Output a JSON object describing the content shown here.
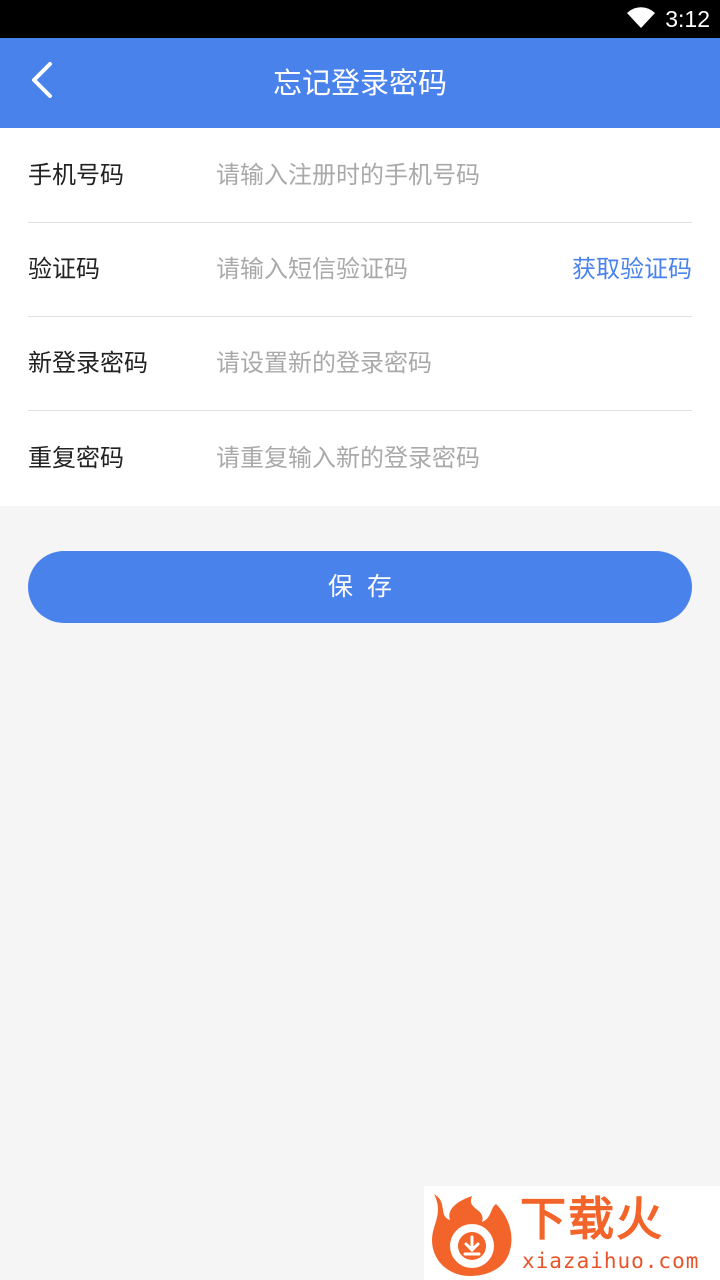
{
  "status_bar": {
    "time": "3:12",
    "wifi_icon": "wifi-icon"
  },
  "header": {
    "back_icon": "chevron-left-icon",
    "title": "忘记登录密码"
  },
  "form": {
    "rows": [
      {
        "label": "手机号码",
        "placeholder": "请输入注册时的手机号码",
        "value": ""
      },
      {
        "label": "验证码",
        "placeholder": "请输入短信验证码",
        "value": "",
        "action_label": "获取验证码"
      },
      {
        "label": "新登录密码",
        "placeholder": "请设置新的登录密码",
        "value": ""
      },
      {
        "label": "重复密码",
        "placeholder": "请重复输入新的登录密码",
        "value": ""
      }
    ]
  },
  "save_button": {
    "label": "保存"
  },
  "watermark": {
    "brand": "下载火",
    "url": "xiazaihuo.com"
  },
  "colors": {
    "accent": "#4a82ec",
    "background": "#f5f5f5",
    "watermark": "#f3642a"
  }
}
